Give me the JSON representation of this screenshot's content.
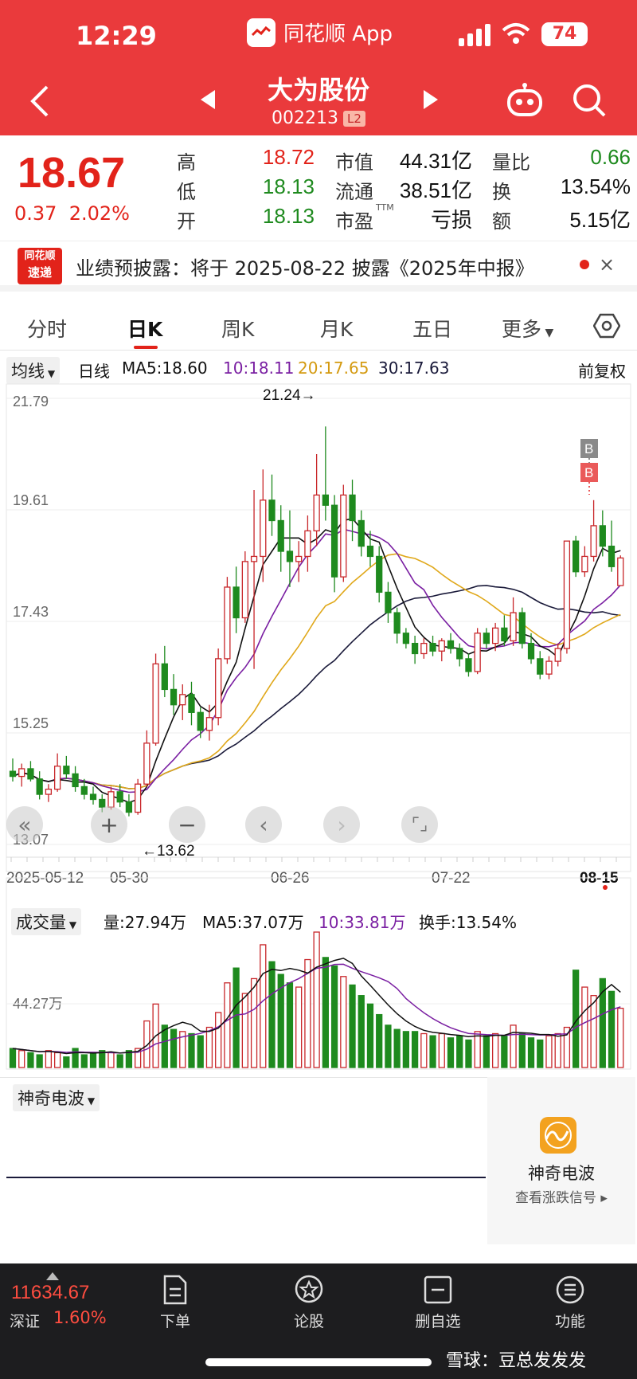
{
  "status": {
    "time": "12:29",
    "app_name": "同花顺 App",
    "battery": "74"
  },
  "header": {
    "stock_name": "大为股份",
    "stock_code": "002213",
    "level_badge": "L2"
  },
  "quote": {
    "price": "18.67",
    "change": "0.37",
    "change_pct": "2.02%",
    "high_label": "高",
    "high": "18.72",
    "low_label": "低",
    "low": "18.13",
    "open_label": "开",
    "open": "18.13",
    "mcap_label": "市值",
    "mcap": "44.31亿",
    "float_label": "流通",
    "float": "38.51亿",
    "pe_label": "市盈",
    "pe_sup": "TTM",
    "pe": "亏损",
    "vr_label": "量比",
    "vr": "0.66",
    "turnover_label": "换",
    "turnover": "13.54%",
    "amount_label": "额",
    "amount": "5.15亿"
  },
  "notice": {
    "logo_line1": "同花顺",
    "logo_line2": "速递",
    "text": "业绩预披露：将于 2025-08-22 披露《2025年中报》",
    "close": "×"
  },
  "tabs": [
    "分时",
    "日K",
    "周K",
    "月K",
    "五日",
    "更多"
  ],
  "indicator_bar": {
    "ma_dropdown": "均线",
    "period": "日线",
    "ma5": "MA5:18.60",
    "ma10": "10:18.11",
    "ma20": "20:17.65",
    "ma30": "30:17.63",
    "adjust": "前复权"
  },
  "kchart_labels": {
    "y_ticks": [
      "21.79",
      "19.61",
      "17.43",
      "15.25",
      "13.07"
    ],
    "max_marker": "21.24→",
    "min_marker": "←13.62",
    "x_ticks": [
      "2025-05-12",
      "05-30",
      "06-26",
      "07-22",
      "08-15"
    ],
    "signal_b1": "B",
    "signal_b2": "B"
  },
  "volume_bar": {
    "dropdown": "成交量",
    "vol": "量:27.94万",
    "ma5": "MA5:37.07万",
    "ma10": "10:33.81万",
    "turnover": "换手:13.54%",
    "y_tick": "44.27万"
  },
  "wave": {
    "dropdown": "神奇电波",
    "card_title": "神奇电波",
    "card_sub": "查看涨跌信号 ▸"
  },
  "bottom": {
    "index_value": "11634.67",
    "index_name": "深证",
    "index_change": "1.60%",
    "items": [
      "下单",
      "论股",
      "删自选",
      "功能"
    ],
    "watermark": "雪球：豆总发发发"
  },
  "colors": {
    "up": "#e2231a",
    "down": "#1e8a1e",
    "header": "#ea3a3c",
    "ma5": "#111111",
    "ma10": "#7a1fa2",
    "ma20": "#e0a81a",
    "ma30": "#1a1a3a"
  },
  "chart_data": {
    "type": "candlestick",
    "ylim": [
      13.07,
      21.79
    ],
    "x_ticks": [
      "2025-05-12",
      "05-30",
      "06-26",
      "07-22",
      "08-15"
    ],
    "candles": [
      [
        14.5,
        14.75,
        14.3,
        14.4
      ],
      [
        14.4,
        14.65,
        14.2,
        14.55
      ],
      [
        14.55,
        14.7,
        14.3,
        14.35
      ],
      [
        14.35,
        14.5,
        13.95,
        14.05
      ],
      [
        14.05,
        14.25,
        13.9,
        14.15
      ],
      [
        14.15,
        14.85,
        14.1,
        14.6
      ],
      [
        14.6,
        14.8,
        14.35,
        14.45
      ],
      [
        14.45,
        14.6,
        14.1,
        14.2
      ],
      [
        14.2,
        14.35,
        13.95,
        14.05
      ],
      [
        14.05,
        14.2,
        13.85,
        13.95
      ],
      [
        13.95,
        14.05,
        13.7,
        13.8
      ],
      [
        13.8,
        14.2,
        13.75,
        14.1
      ],
      [
        14.1,
        14.25,
        13.8,
        13.9
      ],
      [
        13.9,
        14.05,
        13.62,
        13.7
      ],
      [
        13.7,
        14.35,
        13.65,
        14.25
      ],
      [
        14.25,
        15.3,
        14.2,
        15.05
      ],
      [
        15.05,
        16.8,
        15.0,
        16.6
      ],
      [
        16.6,
        16.95,
        15.95,
        16.1
      ],
      [
        16.1,
        16.4,
        15.6,
        15.8
      ],
      [
        15.8,
        16.2,
        15.5,
        16.0
      ],
      [
        16.0,
        16.25,
        15.4,
        15.65
      ],
      [
        15.65,
        15.75,
        15.15,
        15.3
      ],
      [
        15.3,
        15.8,
        15.1,
        15.55
      ],
      [
        15.55,
        16.9,
        15.4,
        16.7
      ],
      [
        16.7,
        18.3,
        16.6,
        18.1
      ],
      [
        18.1,
        18.5,
        17.2,
        17.5
      ],
      [
        17.5,
        18.8,
        17.4,
        18.6
      ],
      [
        18.6,
        20.0,
        16.5,
        18.7
      ],
      [
        18.7,
        20.4,
        18.2,
        19.8
      ],
      [
        19.8,
        20.3,
        19.1,
        19.4
      ],
      [
        19.4,
        19.7,
        18.4,
        18.8
      ],
      [
        18.8,
        19.6,
        18.1,
        18.6
      ],
      [
        18.6,
        19.0,
        18.2,
        18.7
      ],
      [
        18.7,
        19.5,
        18.4,
        19.2
      ],
      [
        19.2,
        20.7,
        18.9,
        19.9
      ],
      [
        19.9,
        21.24,
        19.4,
        19.7
      ],
      [
        19.7,
        19.9,
        18.0,
        18.3
      ],
      [
        18.3,
        20.1,
        18.2,
        19.9
      ],
      [
        19.9,
        20.2,
        19.0,
        19.4
      ],
      [
        19.4,
        19.6,
        18.7,
        18.9
      ],
      [
        18.9,
        19.2,
        18.5,
        18.7
      ],
      [
        18.7,
        18.9,
        17.8,
        18.0
      ],
      [
        18.0,
        18.2,
        17.4,
        17.6
      ],
      [
        17.6,
        17.7,
        17.0,
        17.2
      ],
      [
        17.2,
        17.3,
        16.9,
        17.0
      ],
      [
        17.0,
        17.15,
        16.6,
        16.8
      ],
      [
        16.8,
        17.1,
        16.7,
        17.0
      ],
      [
        17.0,
        17.15,
        16.75,
        16.85
      ],
      [
        16.85,
        17.1,
        16.65,
        17.05
      ],
      [
        17.05,
        17.2,
        16.8,
        16.9
      ],
      [
        16.9,
        17.0,
        16.55,
        16.7
      ],
      [
        16.7,
        16.8,
        16.35,
        16.45
      ],
      [
        16.45,
        17.3,
        16.4,
        17.2
      ],
      [
        17.2,
        17.3,
        16.9,
        17.0
      ],
      [
        17.0,
        17.4,
        16.85,
        17.3
      ],
      [
        17.3,
        17.55,
        16.95,
        17.05
      ],
      [
        17.05,
        17.9,
        16.95,
        17.6
      ],
      [
        17.6,
        17.7,
        16.9,
        17.0
      ],
      [
        17.0,
        17.2,
        16.6,
        16.7
      ],
      [
        16.7,
        16.85,
        16.3,
        16.4
      ],
      [
        16.4,
        16.75,
        16.3,
        16.65
      ],
      [
        16.65,
        17.0,
        16.55,
        16.9
      ],
      [
        16.9,
        19.0,
        16.8,
        19.0
      ],
      [
        19.0,
        19.1,
        18.3,
        18.4
      ],
      [
        18.4,
        18.9,
        18.3,
        18.7
      ],
      [
        18.7,
        19.8,
        18.6,
        19.3
      ],
      [
        19.3,
        19.6,
        18.7,
        18.9
      ],
      [
        18.9,
        19.4,
        18.4,
        18.5
      ],
      [
        18.13,
        18.72,
        18.13,
        18.67
      ]
    ],
    "volume": [
      9,
      8,
      7,
      6,
      8,
      7,
      5,
      9,
      6,
      7,
      8,
      7,
      6,
      8,
      9,
      22,
      30,
      20,
      18,
      17,
      16,
      15,
      19,
      26,
      40,
      47,
      35,
      42,
      58,
      50,
      44,
      40,
      38,
      51,
      64,
      52,
      48,
      43,
      39,
      34,
      30,
      25,
      20,
      18,
      17,
      17,
      16,
      15,
      16,
      14,
      15,
      13,
      17,
      15,
      16,
      15,
      20,
      16,
      14,
      13,
      15,
      16,
      19,
      46,
      38,
      34,
      42,
      36,
      28
    ],
    "volume_unit": "万"
  }
}
